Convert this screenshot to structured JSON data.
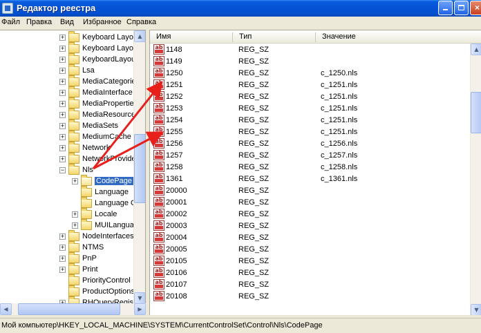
{
  "window": {
    "title": "Редактор реестра",
    "controls": {
      "minimize": "",
      "maximize": "",
      "close": "×"
    }
  },
  "menu": [
    "Файл",
    "Правка",
    "Вид",
    "Избранное",
    "Справка"
  ],
  "tree": {
    "items": [
      {
        "label": "Keyboard Layou",
        "expander": "+",
        "indent": 0
      },
      {
        "label": "Keyboard Layou",
        "expander": "+",
        "indent": 0
      },
      {
        "label": "KeyboardLayou",
        "expander": "+",
        "indent": 0
      },
      {
        "label": "Lsa",
        "expander": "+",
        "indent": 0
      },
      {
        "label": "MediaCategorie",
        "expander": "+",
        "indent": 0
      },
      {
        "label": "MediaInterface",
        "expander": "+",
        "indent": 0
      },
      {
        "label": "MediaProperties",
        "expander": "+",
        "indent": 0
      },
      {
        "label": "MediaResource",
        "expander": "+",
        "indent": 0
      },
      {
        "label": "MediaSets",
        "expander": "+",
        "indent": 0
      },
      {
        "label": "MediumCache",
        "expander": "+",
        "indent": 0
      },
      {
        "label": "Network",
        "expander": "+",
        "indent": 0
      },
      {
        "label": "NetworkProvide",
        "expander": "+",
        "indent": 0
      },
      {
        "label": "Nls",
        "expander": "−",
        "indent": 0
      },
      {
        "label": "CodePage",
        "expander": "+",
        "indent": 1,
        "selected": true
      },
      {
        "label": "Language",
        "expander": "",
        "indent": 1
      },
      {
        "label": "Language G",
        "expander": "",
        "indent": 1
      },
      {
        "label": "Locale",
        "expander": "+",
        "indent": 1
      },
      {
        "label": "MUILangua",
        "expander": "+",
        "indent": 1
      },
      {
        "label": "NodeInterfaces",
        "expander": "+",
        "indent": 0
      },
      {
        "label": "NTMS",
        "expander": "+",
        "indent": 0
      },
      {
        "label": "PnP",
        "expander": "+",
        "indent": 0
      },
      {
        "label": "Print",
        "expander": "+",
        "indent": 0
      },
      {
        "label": "PriorityControl",
        "expander": "",
        "indent": 0
      },
      {
        "label": "ProductOptions",
        "expander": "",
        "indent": 0
      },
      {
        "label": "RHQueryRegist",
        "expander": "+",
        "indent": 0
      }
    ]
  },
  "list": {
    "columns": [
      "Имя",
      "Тип",
      "Значение"
    ],
    "rows": [
      {
        "name": "1148",
        "type": "REG_SZ",
        "value": ""
      },
      {
        "name": "1149",
        "type": "REG_SZ",
        "value": ""
      },
      {
        "name": "1250",
        "type": "REG_SZ",
        "value": "c_1250.nls"
      },
      {
        "name": "1251",
        "type": "REG_SZ",
        "value": "c_1251.nls"
      },
      {
        "name": "1252",
        "type": "REG_SZ",
        "value": "c_1251.nls"
      },
      {
        "name": "1253",
        "type": "REG_SZ",
        "value": "c_1251.nls"
      },
      {
        "name": "1254",
        "type": "REG_SZ",
        "value": "c_1251.nls"
      },
      {
        "name": "1255",
        "type": "REG_SZ",
        "value": "c_1251.nls"
      },
      {
        "name": "1256",
        "type": "REG_SZ",
        "value": "c_1256.nls"
      },
      {
        "name": "1257",
        "type": "REG_SZ",
        "value": "c_1257.nls"
      },
      {
        "name": "1258",
        "type": "REG_SZ",
        "value": "c_1258.nls"
      },
      {
        "name": "1361",
        "type": "REG_SZ",
        "value": "c_1361.nls"
      },
      {
        "name": "20000",
        "type": "REG_SZ",
        "value": ""
      },
      {
        "name": "20001",
        "type": "REG_SZ",
        "value": ""
      },
      {
        "name": "20002",
        "type": "REG_SZ",
        "value": ""
      },
      {
        "name": "20003",
        "type": "REG_SZ",
        "value": ""
      },
      {
        "name": "20004",
        "type": "REG_SZ",
        "value": ""
      },
      {
        "name": "20005",
        "type": "REG_SZ",
        "value": ""
      },
      {
        "name": "20105",
        "type": "REG_SZ",
        "value": ""
      },
      {
        "name": "20106",
        "type": "REG_SZ",
        "value": ""
      },
      {
        "name": "20107",
        "type": "REG_SZ",
        "value": ""
      },
      {
        "name": "20108",
        "type": "REG_SZ",
        "value": ""
      }
    ],
    "value_icon": "string-value-icon"
  },
  "status": {
    "path": "Мой компьютер\\HKEY_LOCAL_MACHINE\\SYSTEM\\CurrentControlSet\\Control\\Nls\\CodePage"
  },
  "colors": {
    "titlebar": "#0653d6",
    "selection": "#316ac5",
    "annotation_arrow": "#e8201c"
  }
}
